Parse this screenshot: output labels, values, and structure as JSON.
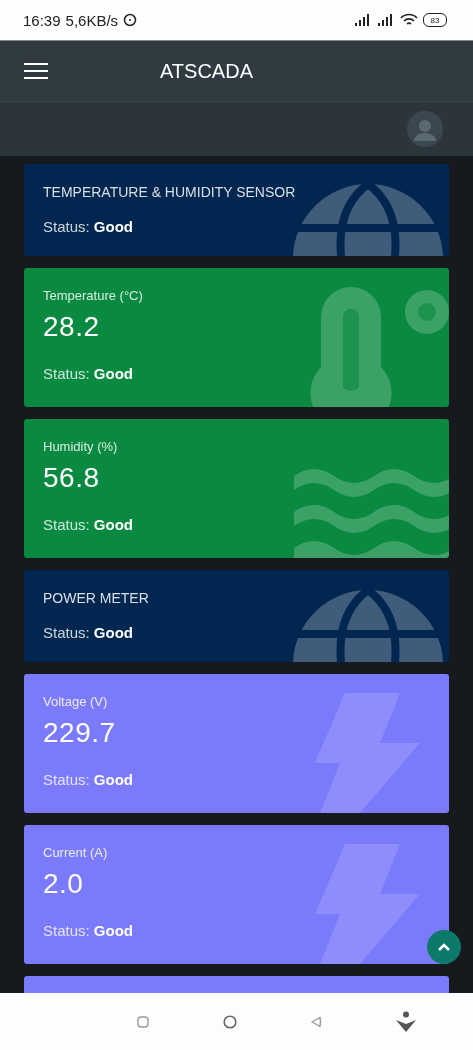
{
  "status_bar": {
    "time": "16:39",
    "speed": "5,6KB/s",
    "battery": "83"
  },
  "app_bar": {
    "title": "ATSCADA"
  },
  "cards": [
    {
      "kind": "device",
      "color": "#01264f",
      "title": "TEMPERATURE & HUMIDITY SENSOR",
      "status": "Status: **Good**"
    },
    {
      "kind": "temperature",
      "color": "#0a8a40",
      "title": "Temperature (°C)",
      "value": "28.2",
      "status": "Status: **Good**"
    },
    {
      "kind": "humidity",
      "color": "#0a8a40",
      "title": "Humidity (%)",
      "value": "56.8",
      "status": "Status: **Good**"
    },
    {
      "kind": "device",
      "color": "#01264f",
      "title": "POWER METER",
      "status": "Status: **Good**"
    },
    {
      "kind": "electric",
      "color": "#7a7afb",
      "title": "Voltage (V)",
      "value": "229.7",
      "status": "Status: **Good**"
    },
    {
      "kind": "electric",
      "color": "#7a7afb",
      "title": "Current (A)",
      "value": "2.0",
      "status": "Status: **Good**"
    },
    {
      "kind": "electric",
      "color": "#7a7afb"
    }
  ]
}
